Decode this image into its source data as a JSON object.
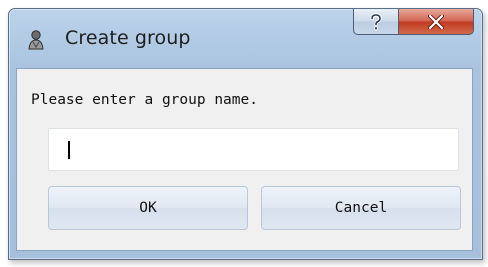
{
  "dialog": {
    "title": "Create group",
    "prompt": "Please enter a group name.",
    "input": {
      "value": "",
      "placeholder": ""
    },
    "buttons": {
      "ok": "OK",
      "cancel": "Cancel"
    },
    "caption": {
      "help": "?",
      "close": "X"
    },
    "icon": "app-icon"
  },
  "colors": {
    "frame": "#a9c3df",
    "close_button": "#c0391f",
    "client_bg": "#f0f0f0"
  }
}
